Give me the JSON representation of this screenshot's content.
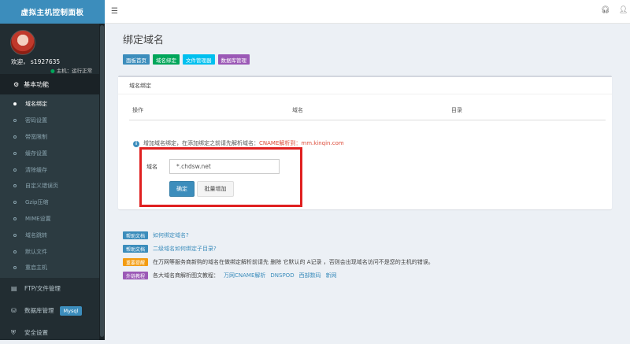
{
  "app": {
    "title": "虚拟主机控制面板"
  },
  "user": {
    "welcome": "欢迎，  s1927635",
    "status": "主机：运行正常"
  },
  "sidebar": {
    "section_header": "基本功能",
    "items": [
      {
        "label": "域名绑定",
        "active": true
      },
      {
        "label": "密码设置"
      },
      {
        "label": "带宽限制"
      },
      {
        "label": "缓存设置"
      },
      {
        "label": "清除缓存"
      },
      {
        "label": "自定义错误页"
      },
      {
        "label": "Gzip压缩"
      },
      {
        "label": "MIME设置"
      },
      {
        "label": "域名跳转"
      },
      {
        "label": "默认文件"
      },
      {
        "label": "重启主机"
      }
    ],
    "menu": [
      {
        "label": "FTP/文件管理"
      },
      {
        "label": "数据库管理",
        "badge": "Mysql"
      },
      {
        "label": "安全设置"
      }
    ]
  },
  "page": {
    "title": "绑定域名",
    "toolbar": [
      "面板首页",
      "域名绑定",
      "文件管理器",
      "数据库管理"
    ],
    "toolbar_colors": [
      "#3c8dbc",
      "#00a65a",
      "#00c0ef",
      "#9b59b6"
    ]
  },
  "box": {
    "title": "域名绑定",
    "columns": [
      "操作",
      "域名",
      "目录"
    ],
    "info_prefix": "增加域名绑定，在添加绑定之前请先解析域名：",
    "info_highlight": "CNAME解析到：mm.kinqin.com",
    "form": {
      "label": "域名",
      "value": "*.chdsw.net",
      "ok_label": "确定",
      "batch_label": "批量增加"
    }
  },
  "help": [
    {
      "badge": "帮助文档",
      "badge_color": "#3c8dbc",
      "text": "如何绑定域名?",
      "is_link": true
    },
    {
      "badge": "帮助文档",
      "badge_color": "#3c8dbc",
      "text": "二级域名如何绑定子目录?",
      "is_link": true
    },
    {
      "badge": "重要提醒",
      "badge_color": "#f39c12",
      "text": "在万网等服务商新购的域名在做绑定解析前请先 删除 它默认的 A记录 ，否则会出现域名访问不是您的主机的错误。",
      "is_link": false
    },
    {
      "badge": "外链教程",
      "badge_color": "#9b59b6",
      "text": "各大域名商解析图文教程：",
      "is_link": false,
      "links": [
        "万网CNAME解析",
        "DNSPOD",
        "西部数码",
        "新网"
      ]
    }
  ],
  "icons": {
    "menu": "hamburger-icon",
    "headset": "headset-icon",
    "user": "user-icon"
  }
}
